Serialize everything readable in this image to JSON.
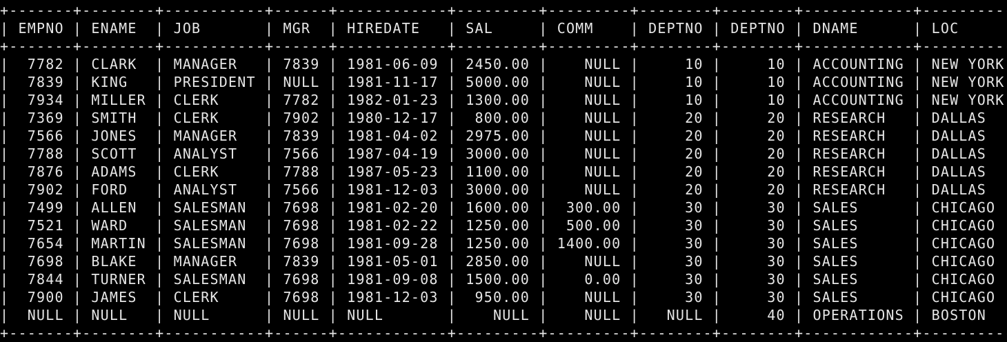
{
  "terminal": {
    "separator": "+-------+--------+-----------+------+------------+---------+---------+--------+--------+------------+----------+",
    "header": "| EMPNO | ENAME  | JOB       | MGR  | HIREDATE   | SAL     | COMM    | DEPTNO | DEPTNO | DNAME      | LOC      |",
    "rows": [
      "|  7782 | CLARK  | MANAGER   | 7839 | 1981-06-09 | 2450.00 |    NULL |     10 |     10 | ACCOUNTING | NEW YORK |",
      "|  7839 | KING   | PRESIDENT | NULL | 1981-11-17 | 5000.00 |    NULL |     10 |     10 | ACCOUNTING | NEW YORK |",
      "|  7934 | MILLER | CLERK     | 7782 | 1982-01-23 | 1300.00 |    NULL |     10 |     10 | ACCOUNTING | NEW YORK |",
      "|  7369 | SMITH  | CLERK     | 7902 | 1980-12-17 |  800.00 |    NULL |     20 |     20 | RESEARCH   | DALLAS   |",
      "|  7566 | JONES  | MANAGER   | 7839 | 1981-04-02 | 2975.00 |    NULL |     20 |     20 | RESEARCH   | DALLAS   |",
      "|  7788 | SCOTT  | ANALYST   | 7566 | 1987-04-19 | 3000.00 |    NULL |     20 |     20 | RESEARCH   | DALLAS   |",
      "|  7876 | ADAMS  | CLERK     | 7788 | 1987-05-23 | 1100.00 |    NULL |     20 |     20 | RESEARCH   | DALLAS   |",
      "|  7902 | FORD   | ANALYST   | 7566 | 1981-12-03 | 3000.00 |    NULL |     20 |     20 | RESEARCH   | DALLAS   |",
      "|  7499 | ALLEN  | SALESMAN  | 7698 | 1981-02-20 | 1600.00 |  300.00 |     30 |     30 | SALES      | CHICAGO  |",
      "|  7521 | WARD   | SALESMAN  | 7698 | 1981-02-22 | 1250.00 |  500.00 |     30 |     30 | SALES      | CHICAGO  |",
      "|  7654 | MARTIN | SALESMAN  | 7698 | 1981-09-28 | 1250.00 | 1400.00 |     30 |     30 | SALES      | CHICAGO  |",
      "|  7698 | BLAKE  | MANAGER   | 7839 | 1981-05-01 | 2850.00 |    NULL |     30 |     30 | SALES      | CHICAGO  |",
      "|  7844 | TURNER | SALESMAN  | 7698 | 1981-09-08 | 1500.00 |    0.00 |     30 |     30 | SALES      | CHICAGO  |",
      "|  7900 | JAMES  | CLERK     | 7698 | 1981-12-03 |  950.00 |    NULL |     30 |     30 | SALES      | CHICAGO  |",
      "|  NULL | NULL   | NULL      | NULL | NULL       |    NULL |    NULL |   NULL |     40 | OPERATIONS | BOSTON   |"
    ]
  }
}
